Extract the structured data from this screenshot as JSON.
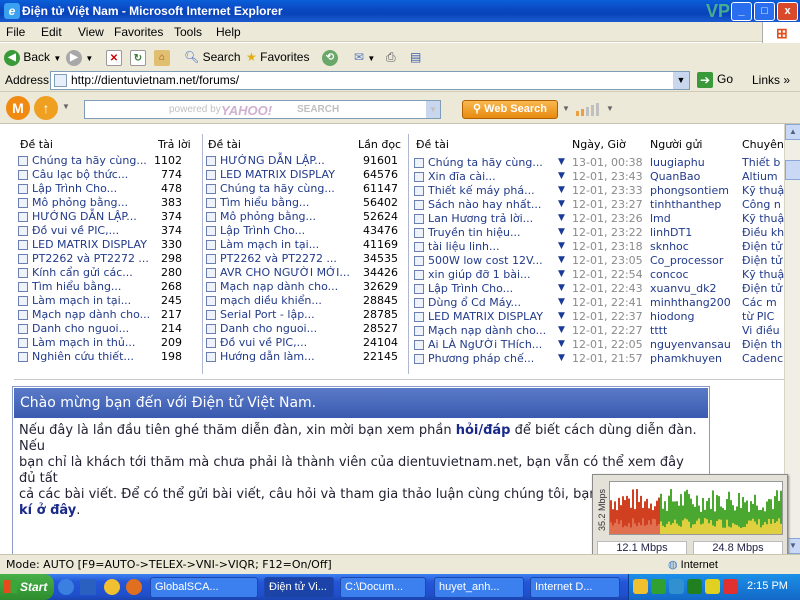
{
  "window": {
    "title": "Điện tử Việt Nam - Microsoft Internet Explorer",
    "watermark": "VPS",
    "controls": {
      "minimize": "_",
      "maximize": "□",
      "close": "x"
    }
  },
  "menu": {
    "items": [
      "File",
      "Edit",
      "View",
      "Favorites",
      "Tools",
      "Help"
    ]
  },
  "toolbar": {
    "back": "Back",
    "search": "Search",
    "favorites": "Favorites"
  },
  "address": {
    "label": "Address",
    "url": "http://dientuvietnam.net/forums/",
    "go": "Go",
    "links": "Links"
  },
  "yahoo": {
    "placeholder": "powered by",
    "logo": "YAHOO!",
    "search_word": "SEARCH",
    "button": "Web Search"
  },
  "panel1": {
    "col_title": "Đề tài",
    "col_count": "Trả lời",
    "rows": [
      {
        "title": "Chúng ta hãy cùng...",
        "count": "1102"
      },
      {
        "title": "Câu lạc bộ thức...",
        "count": "774"
      },
      {
        "title": "Lập Trình Cho...",
        "count": "478"
      },
      {
        "title": "Mô phỏng bằng...",
        "count": "383"
      },
      {
        "title": "HƯỚNG DẪN LẬP...",
        "count": "374"
      },
      {
        "title": "Đồ vui về PIC,...",
        "count": "374"
      },
      {
        "title": "LED MATRIX DISPLAY",
        "count": "330"
      },
      {
        "title": "PT2262 và PT2272 ...",
        "count": "298"
      },
      {
        "title": "Kính cẩn gửi các...",
        "count": "280"
      },
      {
        "title": "Tìm hiểu bằng...",
        "count": "268"
      },
      {
        "title": "Làm mạch in tại...",
        "count": "245"
      },
      {
        "title": "Mạch nạp dành cho...",
        "count": "217"
      },
      {
        "title": "Danh cho nguoi...",
        "count": "214"
      },
      {
        "title": "Làm mạch in thủ...",
        "count": "209"
      },
      {
        "title": "Nghiên cứu thiết...",
        "count": "198"
      }
    ]
  },
  "panel2": {
    "col_title": "Đề tài",
    "col_count": "Lần đọc",
    "rows": [
      {
        "title": "HƯỚNG DẪN LẬP...",
        "count": "91601"
      },
      {
        "title": "LED MATRIX DISPLAY",
        "count": "64576"
      },
      {
        "title": "Chúng ta hãy cùng...",
        "count": "61147"
      },
      {
        "title": "Tìm hiểu bằng...",
        "count": "56402"
      },
      {
        "title": "Mô phỏng bằng...",
        "count": "52624"
      },
      {
        "title": "Lập Trình Cho...",
        "count": "43476"
      },
      {
        "title": "Làm mạch in tại...",
        "count": "41169"
      },
      {
        "title": "PT2262 và PT2272 ...",
        "count": "34535"
      },
      {
        "title": "AVR CHO NGƯỜI MỚI...",
        "count": "34426"
      },
      {
        "title": "Mạch nạp dành cho...",
        "count": "32629"
      },
      {
        "title": "mạch diều khiển...",
        "count": "28845"
      },
      {
        "title": "Serial Port - lập...",
        "count": "28785"
      },
      {
        "title": "Danh cho nguoi...",
        "count": "28527"
      },
      {
        "title": "Đồ vui về PIC,...",
        "count": "24104"
      },
      {
        "title": "Hướng dẫn làm...",
        "count": "22145"
      }
    ]
  },
  "panel3": {
    "col_title": "Đề tài",
    "col_date": "Ngày, Giờ",
    "col_user": "Người gửi",
    "col_forum": "Chuyên",
    "rows": [
      {
        "title": "Chúng ta hãy cùng...",
        "date": "13-01, 00:38",
        "user": "luugiaphu",
        "forum": "Thiết b"
      },
      {
        "title": "Xin đĩa cài...",
        "date": "12-01, 23:43",
        "user": "QuanBao",
        "forum": "Altium"
      },
      {
        "title": "Thiết kế máy phá...",
        "date": "12-01, 23:33",
        "user": "phongsontiem",
        "forum": "Kỹ thuậ"
      },
      {
        "title": "Sách nào hay nhất...",
        "date": "12-01, 23:27",
        "user": "tinhthanthep",
        "forum": "Công n"
      },
      {
        "title": "Lan Hương trả lời...",
        "date": "12-01, 23:26",
        "user": "lmd",
        "forum": "Kỹ thuậ"
      },
      {
        "title": "Truyền tin hiệu...",
        "date": "12-01, 23:22",
        "user": "linhDT1",
        "forum": "Điều kh"
      },
      {
        "title": "tài liệu linh...",
        "date": "12-01, 23:18",
        "user": "sknhoc",
        "forum": "Điện tử"
      },
      {
        "title": "500W low cost 12V...",
        "date": "12-01, 23:05",
        "user": "Co_processor",
        "forum": "Điện tử"
      },
      {
        "title": "xin giúp đỡ 1 bài...",
        "date": "12-01, 22:54",
        "user": "concoc",
        "forum": "Kỹ thuậ"
      },
      {
        "title": "Lập Trình Cho...",
        "date": "12-01, 22:43",
        "user": "xuanvu_dk2",
        "forum": "Điện tử"
      },
      {
        "title": "Dùng ổ Cd Máy...",
        "date": "12-01, 22:41",
        "user": "minhthang200",
        "forum": "Các m"
      },
      {
        "title": "LED MATRIX DISPLAY",
        "date": "12-01, 22:37",
        "user": "hiodong",
        "forum": "từ PIC"
      },
      {
        "title": "Mạch nạp dành cho...",
        "date": "12-01, 22:27",
        "user": "tttt",
        "forum": "Vi điều"
      },
      {
        "title": "Ai LÀ NgƯỜi THích...",
        "date": "12-01, 22:05",
        "user": "nguyenvansau",
        "forum": "Điện th"
      },
      {
        "title": "Phương pháp chế...",
        "date": "12-01, 21:57",
        "user": "phamkhuyen",
        "forum": "Cadenc"
      }
    ]
  },
  "welcome": {
    "title": "Chào mừng bạn đến với Điện tử Việt Nam.",
    "line1a": "Nếu đây là lần đầu tiên ghé thăm diễn đàn, xin mời bạn xem phần ",
    "line1_link": "hỏi/đáp",
    "line1b": " để biết cách dùng diễn đàn. Nếu",
    "line2": "bạn chỉ là khách tới thăm mà chưa phải là thành viên của dientuvietnam.net, bạn vẫn có thể xem đây đủ tất",
    "line3": "cả các bài viết. Để có thể gửi bài viết, câu hỏi và tham gia thảo luận cùng chúng tôi, bạn hãy đăng",
    "line4_link": "kí ở đây",
    "line4_end": "."
  },
  "bandwidth": {
    "ylabel": "35.2 Mbps",
    "down": "12.1 Mbps",
    "up": "24.8 Mbps"
  },
  "status": {
    "text": "Mode: AUTO [F9=AUTO->TELEX->VNI->VIQR; F12=On/Off]",
    "zone": "Internet"
  },
  "taskbar": {
    "start": "Start",
    "tasks": [
      "GlobalSCA...",
      "Điện tử Vi...",
      "C:\\Docum...",
      "huyet_anh...",
      "Internet D..."
    ],
    "clock": "2:15 PM"
  },
  "colors": {
    "title_blue": "#0b49c4",
    "link_blue": "#223a8a",
    "taskbar_blue": "#2456d8",
    "start_green": "#38a838"
  }
}
